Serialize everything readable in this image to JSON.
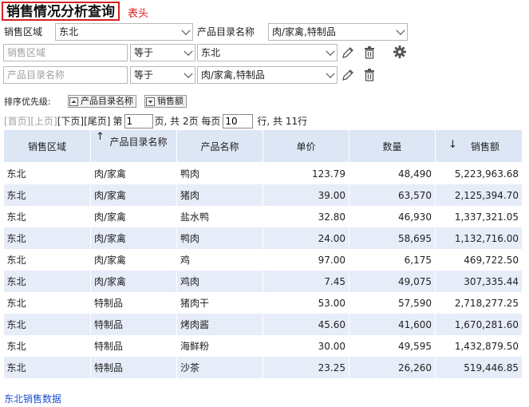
{
  "header": {
    "title": "销售情况分析查询",
    "tag": "表头"
  },
  "filters": {
    "row1": {
      "region_label": "销售区域",
      "region_value": "东北",
      "catalog_label": "产品目录名称",
      "catalog_value": "肉/家禽,特制品"
    },
    "row2": {
      "field_placeholder": "销售区域",
      "operator": "等于",
      "value": "东北"
    },
    "row3": {
      "field_placeholder": "产品目录名称",
      "operator": "等于",
      "value": "肉/家禽,特制品"
    }
  },
  "sort": {
    "label": "排序优先级:",
    "items": [
      {
        "label": "产品目录名称",
        "direction": "asc"
      },
      {
        "label": "销售额",
        "direction": "desc"
      }
    ]
  },
  "pager": {
    "first": "[首页]",
    "prev": "[上页]",
    "next": "[下页]",
    "last": "[尾页]",
    "page_prefix": "第",
    "page_value": "1",
    "page_suffix": "页, 共 2页 每页",
    "per_page_value": "10",
    "total_text": "行, 共 11行"
  },
  "table": {
    "columns": [
      "销售区域",
      "产品目录名称",
      "产品名称",
      "单价",
      "数量",
      "销售额"
    ],
    "sort_arrows": {
      "catalog": "↑",
      "sales": "↓"
    },
    "rows": [
      [
        "东北",
        "肉/家禽",
        "鸭肉",
        "123.79",
        "48,490",
        "5,223,963.68"
      ],
      [
        "东北",
        "肉/家禽",
        "猪肉",
        "39.00",
        "63,570",
        "2,125,394.70"
      ],
      [
        "东北",
        "肉/家禽",
        "盐水鸭",
        "32.80",
        "46,930",
        "1,337,321.05"
      ],
      [
        "东北",
        "肉/家禽",
        "鸭肉",
        "24.00",
        "58,695",
        "1,132,716.00"
      ],
      [
        "东北",
        "肉/家禽",
        "鸡",
        "97.00",
        "6,175",
        "469,722.50"
      ],
      [
        "东北",
        "肉/家禽",
        "鸡肉",
        "7.45",
        "49,075",
        "307,335.44"
      ],
      [
        "东北",
        "特制品",
        "猪肉干",
        "53.00",
        "57,590",
        "2,718,277.25"
      ],
      [
        "东北",
        "特制品",
        "烤肉酱",
        "45.60",
        "41,600",
        "1,670,281.60"
      ],
      [
        "东北",
        "特制品",
        "海鲜粉",
        "30.00",
        "49,595",
        "1,432,879.50"
      ],
      [
        "东北",
        "特制品",
        "沙茶",
        "23.25",
        "26,260",
        "519,446.85"
      ]
    ]
  },
  "footer": {
    "link": "东北销售数据"
  },
  "colors": {
    "accent_red": "#d62222",
    "header_bg": "#dce6f5",
    "stripe": "#e6ecf8",
    "link": "#1a4fd0"
  },
  "icons": [
    "pencil-icon",
    "trash-icon",
    "gear-icon",
    "sort-asc-icon",
    "sort-desc-icon"
  ]
}
